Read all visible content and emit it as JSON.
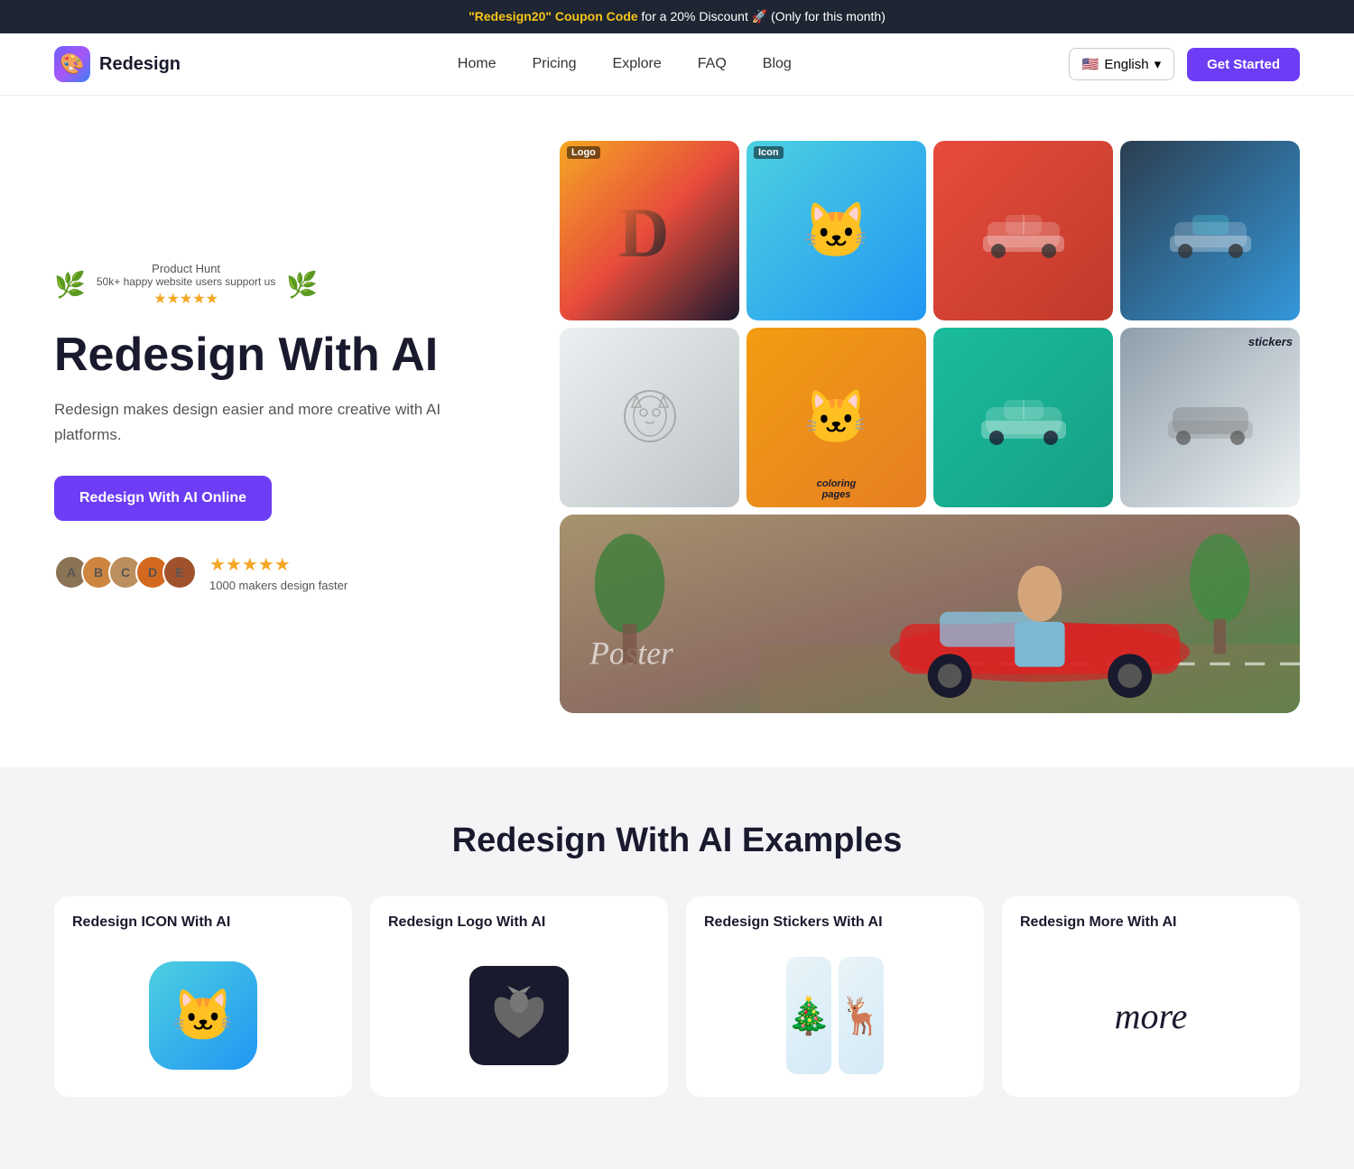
{
  "banner": {
    "coupon_highlight": "\"Redesign20\" Coupon Code",
    "coupon_rest": " for a 20% Discount 🚀  (Only for this month)"
  },
  "nav": {
    "logo_text": "Redesign",
    "links": [
      {
        "label": "Home",
        "id": "home"
      },
      {
        "label": "Pricing",
        "id": "pricing"
      },
      {
        "label": "Explore",
        "id": "explore"
      },
      {
        "label": "FAQ",
        "id": "faq"
      },
      {
        "label": "Blog",
        "id": "blog"
      }
    ],
    "lang_label": "English",
    "cta_label": "Get Started"
  },
  "hero": {
    "ph_title": "Product Hunt",
    "ph_subtitle": "50k+ happy website users support us",
    "ph_stars": "★★★★★",
    "heading": "Redesign With AI",
    "subtext": "Redesign makes design easier and more creative with AI platforms.",
    "cta_label": "Redesign With AI Online",
    "proof_text": "1000 makers design faster",
    "proof_stars": "★★★★★"
  },
  "examples": {
    "section_title": "Redesign With AI Examples",
    "cards": [
      {
        "title": "Redesign ICON With AI",
        "type": "icon"
      },
      {
        "title": "Redesign Logo With AI",
        "type": "logo"
      },
      {
        "title": "Redesign Stickers With AI",
        "type": "stickers"
      },
      {
        "title": "Redesign More With AI",
        "type": "more"
      }
    ]
  },
  "colors": {
    "accent": "#6c3df5",
    "banner_bg": "#1e2533",
    "coupon_color": "#f5c518",
    "star_color": "#f5a623"
  }
}
